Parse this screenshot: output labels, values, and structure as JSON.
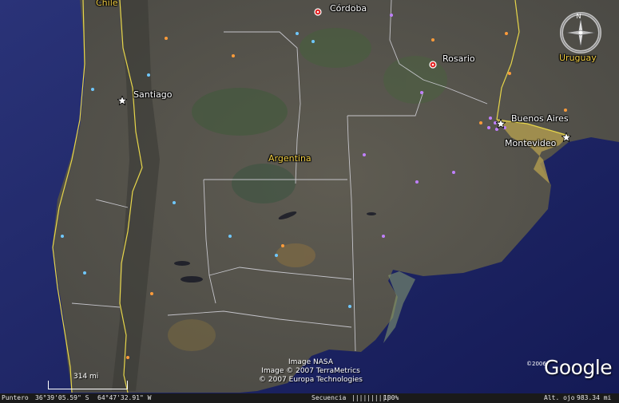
{
  "map": {
    "country_labels": [
      {
        "id": "chile",
        "text": "Chile"
      },
      {
        "id": "argentina",
        "text": "Argentina"
      },
      {
        "id": "uruguay",
        "text": "Uruguay"
      }
    ],
    "city_labels": [
      {
        "id": "cordoba",
        "text": "Córdoba"
      },
      {
        "id": "rosario",
        "text": "Rosario"
      },
      {
        "id": "santiago",
        "text": "Santiago"
      },
      {
        "id": "buenos-aires",
        "text": "Buenos Aires"
      },
      {
        "id": "montevideo",
        "text": "Montevideo"
      }
    ],
    "colors": {
      "ocean": "#1c2466",
      "land": "#57554c",
      "country_border": "#e7d64a",
      "province_border": "#d8d8e0",
      "shallow_water": "#b8a24f",
      "capital_marker": "#ffffff",
      "city_marker": "#e11f1f",
      "poi_purple": "#c080ff",
      "poi_blue": "#6fc8ff",
      "poi_orange": "#ff9c3a"
    }
  },
  "compass": {
    "north": "N",
    "icon": "compass-rose-icon"
  },
  "credits": [
    "Image NASA",
    "Image © 2007 TerraMetrics",
    "© 2007 Europa Technologies"
  ],
  "brand": {
    "name": "Google",
    "year": "©2006"
  },
  "scale": {
    "label": "314 mi"
  },
  "status": {
    "pointer_label": "Puntero",
    "pointer_lat": "36°39'05.59\"  S",
    "pointer_lon": "64°47'32.91\"  W",
    "streaming_label": "Secuencia",
    "streaming_bar": "||||||||||",
    "streaming_pct": "100%",
    "eye_alt_label": "Alt. ojo",
    "eye_alt_value": "983.34 mi"
  }
}
